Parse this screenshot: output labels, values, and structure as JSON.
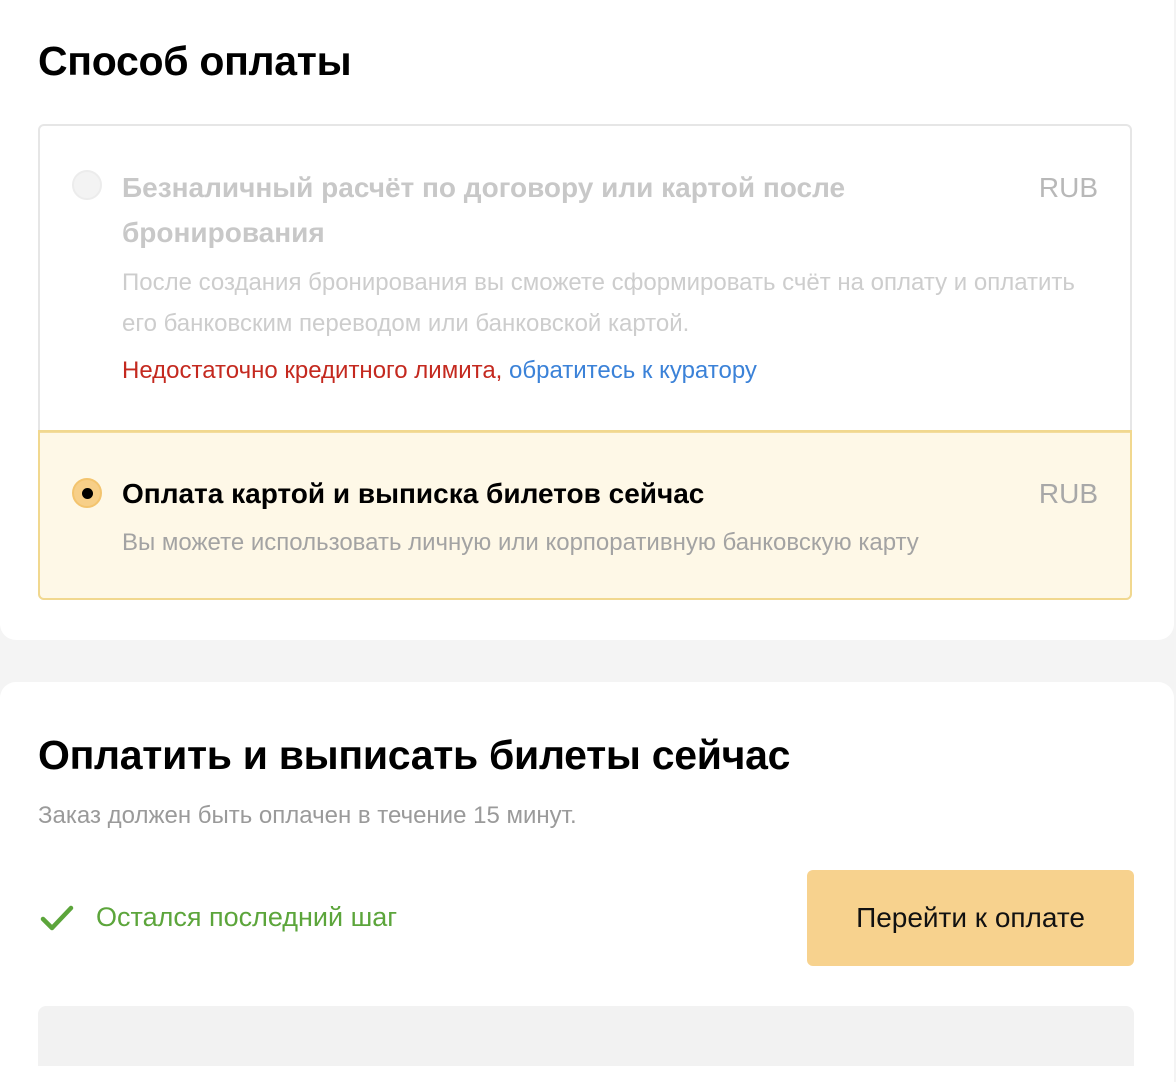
{
  "payment_method": {
    "title": "Способ оплаты",
    "options": [
      {
        "title": "Безналичный расчёт по договору или картой после бронирования",
        "currency": "RUB",
        "description": "После создания бронирования вы сможете сформировать счёт на оплату и оплатить его банковским переводом или банковской картой.",
        "warning_text": "Недостаточно кредитного лимита,",
        "warning_link": "обратитесь к куратору",
        "state": "disabled"
      },
      {
        "title": "Оплата картой и выписка билетов сейчас",
        "currency": "RUB",
        "description": "Вы можете использовать личную или корпоративную банковскую карту",
        "state": "selected"
      }
    ]
  },
  "pay_now": {
    "title": "Оплатить и выписать билеты сейчас",
    "subtitle": "Заказ должен быть оплачен в течение 15 минут.",
    "status_text": "Остался последний шаг",
    "button_label": "Перейти к оплате"
  },
  "colors": {
    "selected_bg": "#fef8e7",
    "selected_border": "#f1d88f",
    "button_bg": "#f7d28e",
    "warning_red": "#c4291f",
    "link_blue": "#3b82d8",
    "success_green": "#5ca53b"
  },
  "icons": {
    "status": "check-icon"
  }
}
